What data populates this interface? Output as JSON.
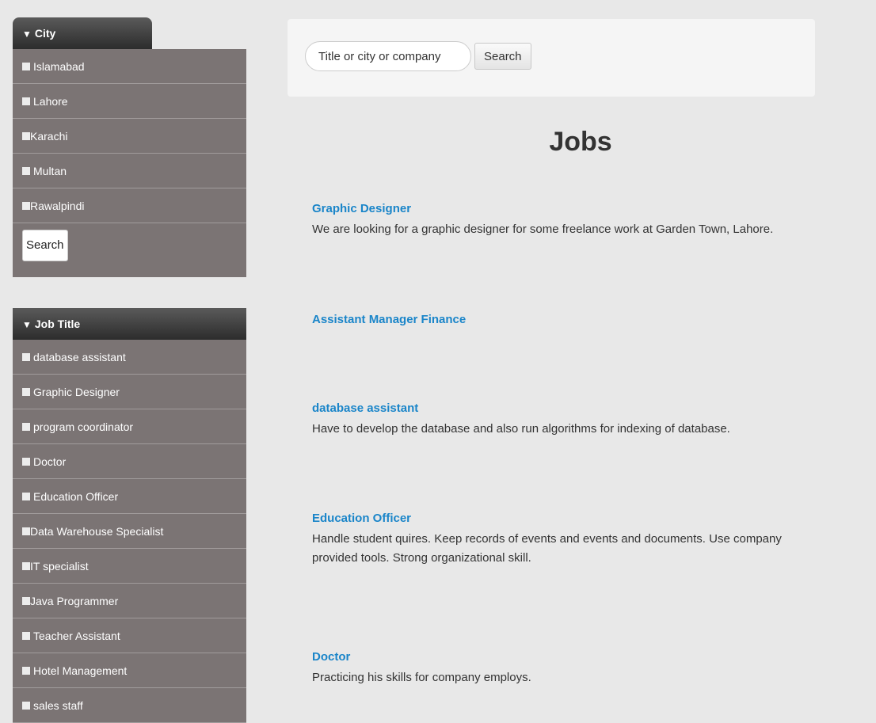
{
  "city_filter": {
    "header": "City",
    "items": [
      "Islamabad",
      "Lahore",
      "Karachi",
      "Multan",
      "Rawalpindi"
    ],
    "search_label": "Search"
  },
  "job_title_filter": {
    "header": "Job Title",
    "items": [
      "database assistant",
      "Graphic Designer",
      "program coordinator",
      "Doctor",
      "Education Officer",
      "Data Warehouse Specialist",
      "IT specialist",
      "Java Programmer",
      "Teacher Assistant",
      "Hotel Management",
      "sales staff"
    ]
  },
  "search": {
    "placeholder": "Title or city or company",
    "button_label": "Search"
  },
  "page_title": "Jobs",
  "jobs": [
    {
      "title": "Graphic Designer",
      "description": "We are looking for a graphic designer for some freelance work at Garden Town, Lahore."
    },
    {
      "title": "Assistant Manager Finance",
      "description": ""
    },
    {
      "title": "database assistant",
      "description": "Have to develop the database and also run algorithms for indexing of database."
    },
    {
      "title": "Education Officer",
      "description": "Handle student quires. Keep records of events and events and documents. Use company provided tools. Strong organizational skill."
    },
    {
      "title": "Doctor",
      "description": "Practicing his skills for company employs."
    }
  ],
  "colors": {
    "accent_link": "#1a85c9",
    "sidebar_bg": "#7b7474",
    "header_dark": "#2c2c2c"
  }
}
